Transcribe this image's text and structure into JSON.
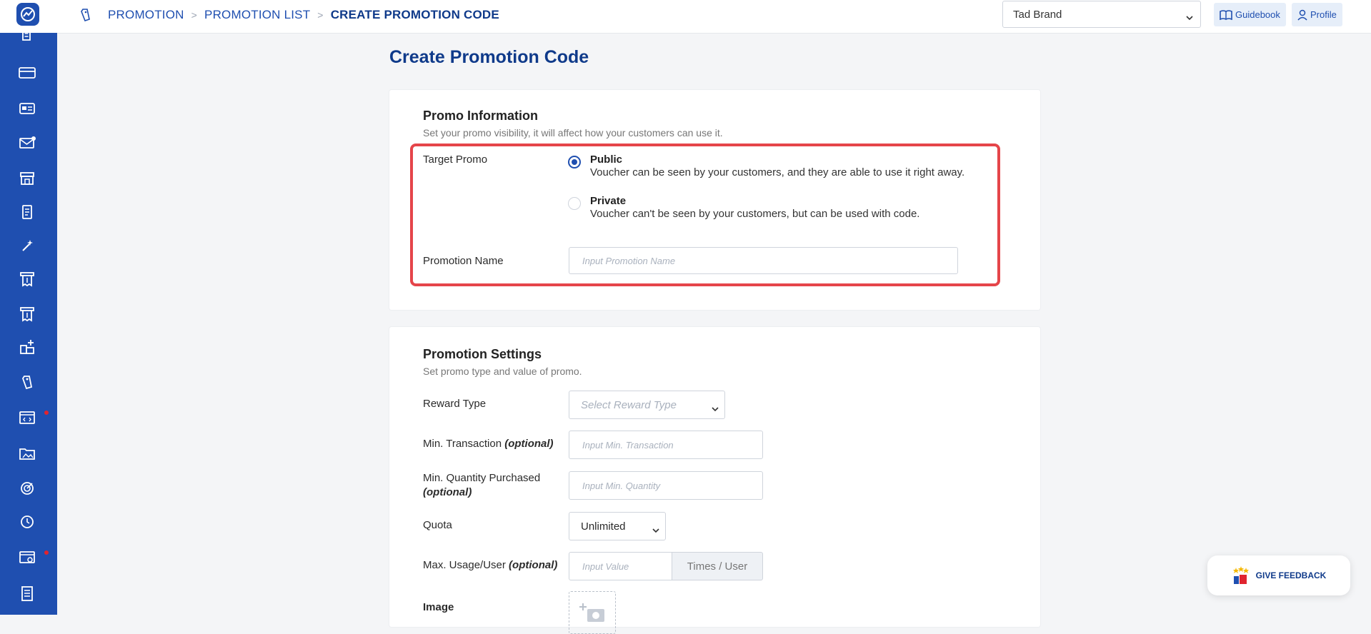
{
  "breadcrumb": {
    "items": [
      "PROMOTION",
      "PROMOTION LIST"
    ],
    "current": "CREATE PROMOTION CODE"
  },
  "header": {
    "brand_selected": "Tad Brand",
    "guidebook_label": "Guidebook",
    "profile_label": "Profile"
  },
  "page": {
    "title": "Create Promotion Code"
  },
  "promo_info": {
    "title": "Promo Information",
    "subtitle": "Set your promo visibility, it will affect how your customers can use it.",
    "target_label": "Target Promo",
    "options": [
      {
        "title": "Public",
        "desc": "Voucher can be seen by your customers, and they are able to use it right away.",
        "selected": true
      },
      {
        "title": "Private",
        "desc": "Voucher can't be seen by your customers, but can be used with code.",
        "selected": false
      }
    ],
    "name_label": "Promotion Name",
    "name_placeholder": "Input Promotion Name"
  },
  "promo_settings": {
    "title": "Promotion Settings",
    "subtitle": "Set promo type and value of promo.",
    "reward_type_label": "Reward Type",
    "reward_type_placeholder": "Select Reward Type",
    "min_transaction_label": "Min. Transaction",
    "optional_text": "(optional)",
    "min_transaction_placeholder": "Input Min. Transaction",
    "min_qty_label": "Min. Quantity Purchased",
    "min_qty_placeholder": "Input Min. Quantity",
    "quota_label": "Quota",
    "quota_value": "Unlimited",
    "max_usage_label": "Max. Usage/User",
    "max_usage_placeholder": "Input Value",
    "max_usage_addon": "Times / User",
    "image_label": "Image"
  },
  "feedback": {
    "label": "GIVE FEEDBACK"
  },
  "colors": {
    "primary": "#1f4fb0",
    "title": "#0f3a8a",
    "highlight": "#e5454a",
    "alert_dot": "#e0242f"
  }
}
